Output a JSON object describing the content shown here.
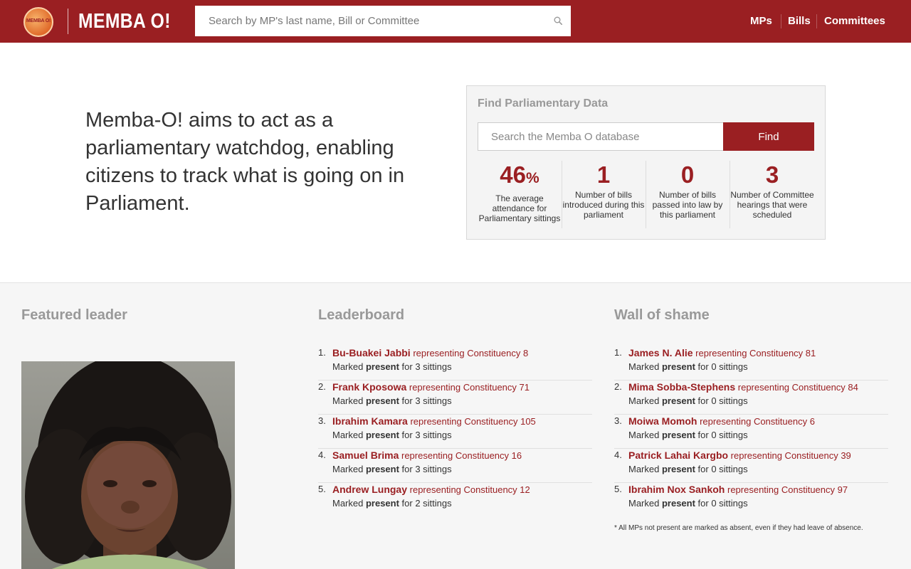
{
  "header": {
    "logo_badge_text": "MEMBA O!",
    "logo_text": "MEMBA O!",
    "search_placeholder": "Search by MP's last name, Bill or Committee",
    "nav": [
      "MPs",
      "Bills",
      "Committees"
    ]
  },
  "hero": {
    "tagline": "Memba-O! aims to act as a parliamentary watchdog, enabling citizens to track what is going on in Parliament."
  },
  "finder": {
    "title": "Find Parliamentary Data",
    "placeholder": "Search the Memba O database",
    "button": "Find",
    "stats": [
      {
        "value": "46",
        "suffix": "%",
        "label": "The average attendance for Parliamentary sittings"
      },
      {
        "value": "1",
        "suffix": "",
        "label": "Number of bills introduced during this parliament"
      },
      {
        "value": "0",
        "suffix": "",
        "label": "Number of bills passed into law by this parliament"
      },
      {
        "value": "3",
        "suffix": "",
        "label": "Number of Committee hearings that were scheduled"
      }
    ]
  },
  "featured": {
    "title": "Featured leader"
  },
  "leaderboard": {
    "title": "Leaderboard",
    "items": [
      {
        "rank": "1.",
        "name": "Bu-Buakei Jabbi",
        "rep": "representing Constituency 8",
        "prefix": "Marked ",
        "status": "present",
        "suffix": " for 3 sittings"
      },
      {
        "rank": "2.",
        "name": "Frank Kposowa",
        "rep": "representing Constituency 71",
        "prefix": "Marked ",
        "status": "present",
        "suffix": " for 3 sittings"
      },
      {
        "rank": "3.",
        "name": "Ibrahim Kamara",
        "rep": "representing Constituency 105",
        "prefix": "Marked ",
        "status": "present",
        "suffix": " for 3 sittings"
      },
      {
        "rank": "4.",
        "name": "Samuel Brima",
        "rep": "representing Constituency 16",
        "prefix": "Marked ",
        "status": "present",
        "suffix": " for 3 sittings"
      },
      {
        "rank": "5.",
        "name": "Andrew Lungay",
        "rep": "representing Constituency 12",
        "prefix": "Marked ",
        "status": "present",
        "suffix": " for 2 sittings"
      }
    ]
  },
  "wall_of_shame": {
    "title": "Wall of shame",
    "items": [
      {
        "rank": "1.",
        "name": "James N. Alie",
        "rep": "representing Constituency 81",
        "prefix": "Marked ",
        "status": "present",
        "suffix": " for 0 sittings"
      },
      {
        "rank": "2.",
        "name": "Mima Sobba-Stephens",
        "rep": "representing Constituency 84",
        "prefix": "Marked ",
        "status": "present",
        "suffix": " for 0 sittings"
      },
      {
        "rank": "3.",
        "name": "Moiwa Momoh",
        "rep": "representing Constituency 6",
        "prefix": "Marked ",
        "status": "present",
        "suffix": " for 0 sittings"
      },
      {
        "rank": "4.",
        "name": "Patrick Lahai Kargbo",
        "rep": "representing Constituency 39",
        "prefix": "Marked ",
        "status": "present",
        "suffix": " for 0 sittings"
      },
      {
        "rank": "5.",
        "name": "Ibrahim Nox Sankoh",
        "rep": "representing Constituency 97",
        "prefix": "Marked ",
        "status": "present",
        "suffix": " for 0 sittings"
      }
    ],
    "footnote": "* All MPs not present are marked as absent, even if they had leave of absence."
  },
  "colors": {
    "brand": "#9a1f22",
    "heading_gray": "#999999",
    "lower_bg": "#f6f6f6"
  }
}
